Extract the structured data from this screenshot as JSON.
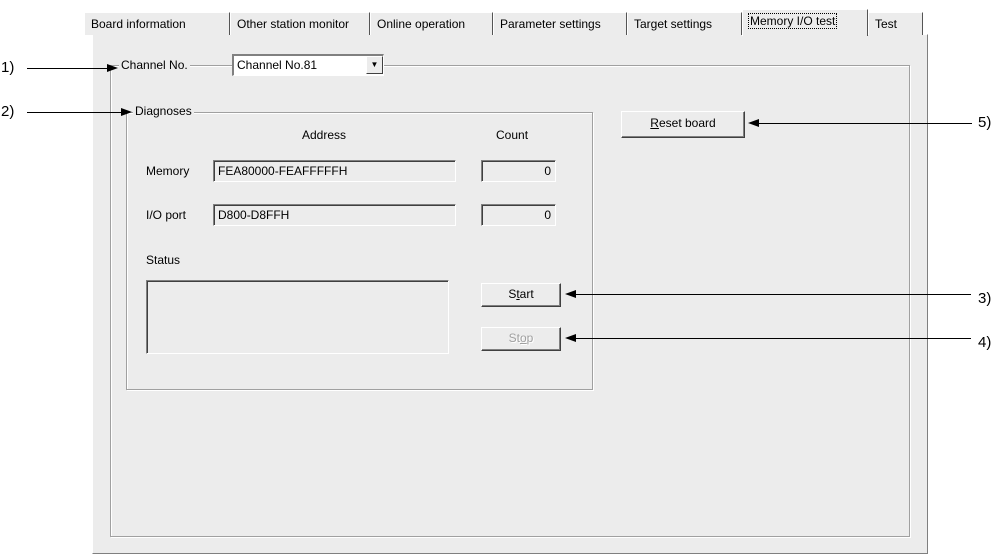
{
  "tabs": [
    {
      "label": "Board information",
      "active": false
    },
    {
      "label": "Other station monitor",
      "active": false
    },
    {
      "label": "Online operation",
      "active": false
    },
    {
      "label": "Parameter settings",
      "active": false
    },
    {
      "label": "Target settings",
      "active": false
    },
    {
      "label": "Memory I/O test",
      "active": true
    },
    {
      "label": "Test",
      "active": false
    }
  ],
  "channel": {
    "legend": "Channel No.",
    "selected": "Channel No.81"
  },
  "diagnoses": {
    "legend": "Diagnoses",
    "address_header": "Address",
    "count_header": "Count",
    "memory": {
      "label": "Memory",
      "address": "FEA80000-FEAFFFFFH",
      "count": "0"
    },
    "io_port": {
      "label": "I/O port",
      "address": "D800-D8FFH",
      "count": "0"
    },
    "status_label": "Status",
    "status_text": "",
    "start_label": {
      "pre": "S",
      "key": "t",
      "post": "art"
    },
    "stop_label": {
      "pre": "St",
      "key": "o",
      "post": "p"
    }
  },
  "reset_button": {
    "key": "R",
    "post": "eset board"
  },
  "callouts": {
    "c1": "1)",
    "c2": "2)",
    "c3": "3)",
    "c4": "4)",
    "c5": "5)"
  }
}
